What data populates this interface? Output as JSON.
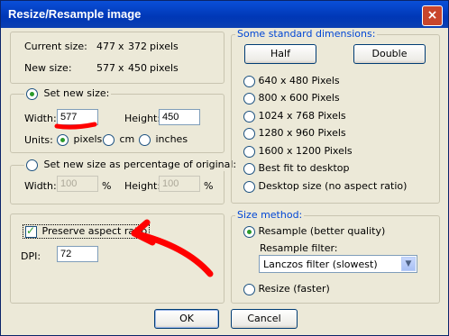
{
  "window": {
    "title": "Resize/Resample image",
    "close_glyph": "×"
  },
  "current": {
    "label": "Current size:",
    "w": "477",
    "x": "x",
    "h": "372",
    "unit": "pixels"
  },
  "newsize": {
    "label": "New size:",
    "w": "577",
    "x": "x",
    "h": "450",
    "unit": "pixels"
  },
  "set_new": {
    "radio_label": "Set new size:",
    "width_label": "Width:",
    "width_value": "577",
    "height_label": "Height:",
    "height_value": "450",
    "units_label": "Units:",
    "units": [
      "pixels",
      "cm",
      "inches"
    ]
  },
  "percent": {
    "radio_label": "Set new size as percentage of original:",
    "width_label": "Width:",
    "width_value": "100",
    "height_label": "Height:",
    "height_value": "100",
    "pct": "%"
  },
  "aspect": {
    "label": "Preserve aspect ratio",
    "checked": true
  },
  "dpi": {
    "label": "DPI:",
    "value": "72"
  },
  "std": {
    "legend": "Some standard dimensions:",
    "half": "Half",
    "double": "Double",
    "options": [
      "640 x 480 Pixels",
      "800 x 600 Pixels",
      "1024 x 768 Pixels",
      "1280 x 960 Pixels",
      "1600 x 1200 Pixels",
      "Best fit to desktop",
      "Desktop size (no aspect ratio)"
    ]
  },
  "method": {
    "legend": "Size method:",
    "resample": "Resample (better quality)",
    "filter_label": "Resample filter:",
    "filter_value": "Lanczos filter (slowest)",
    "resize": "Resize (faster)"
  },
  "buttons": {
    "ok": "OK",
    "cancel": "Cancel"
  },
  "colors": {
    "annotation": "#ff0000",
    "title_bar": "#0a4fd8"
  }
}
